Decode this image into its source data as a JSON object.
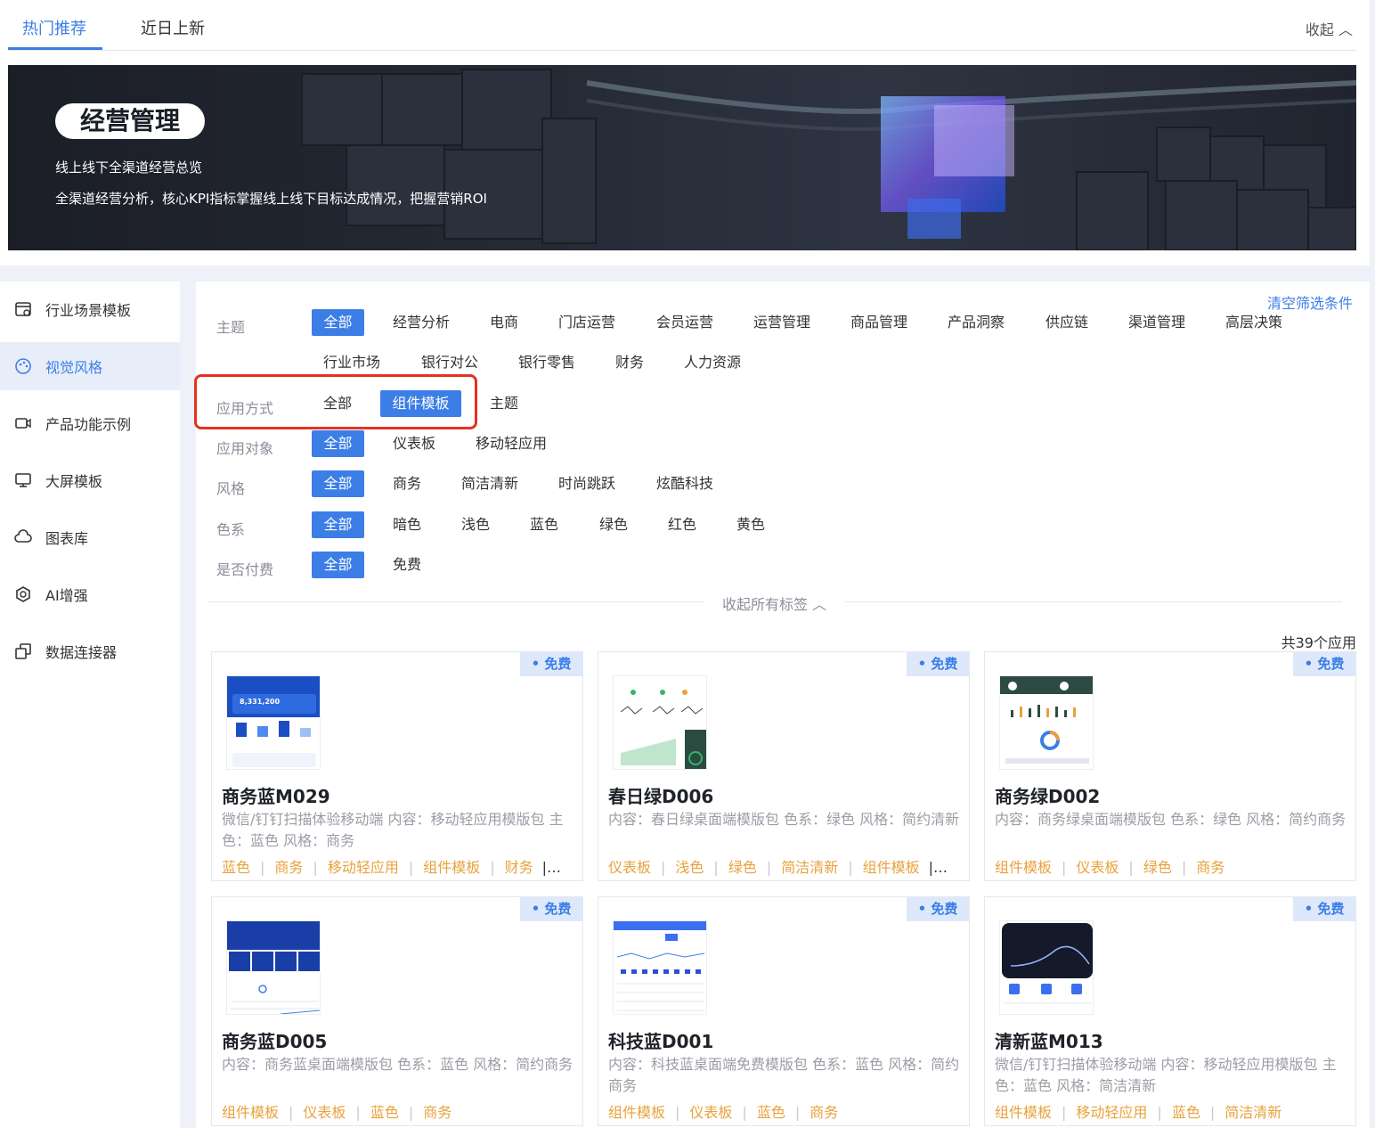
{
  "tabs": [
    {
      "label": "热门推荐"
    },
    {
      "label": "近日上新"
    }
  ],
  "collapse_label": "收起 ︿",
  "banner": {
    "title": "经营管理",
    "subtitle": "线上线下全渠道经营总览",
    "description": "全渠道经营分析，核心KPI指标掌握线上线下目标达成情况，把握营销ROI"
  },
  "sidebar": {
    "items": [
      {
        "label": "行业场景模板",
        "icon": "template-icon"
      },
      {
        "label": "视觉风格",
        "icon": "palette-icon"
      },
      {
        "label": "产品功能示例",
        "icon": "video-icon"
      },
      {
        "label": "大屏模板",
        "icon": "monitor-icon"
      },
      {
        "label": "图表库",
        "icon": "cloud-icon"
      },
      {
        "label": "AI增强",
        "icon": "hexagon-icon"
      },
      {
        "label": "数据连接器",
        "icon": "connector-icon"
      }
    ],
    "active_index": 1
  },
  "filters": {
    "clear_label": "清空筛选条件",
    "rows": [
      {
        "label": "主题",
        "options": [
          "全部",
          "经营分析",
          "电商",
          "门店运营",
          "会员运营",
          "运营管理",
          "商品管理",
          "产品洞察",
          "供应链",
          "渠道管理",
          "高层决策",
          "行业市场",
          "银行对公",
          "银行零售",
          "财务",
          "人力资源"
        ],
        "selected": 0
      },
      {
        "label": "应用方式",
        "options": [
          "全部",
          "组件模板",
          "主题"
        ],
        "selected": 1
      },
      {
        "label": "应用对象",
        "options": [
          "全部",
          "仪表板",
          "移动轻应用"
        ],
        "selected": 0
      },
      {
        "label": "风格",
        "options": [
          "全部",
          "商务",
          "简洁清新",
          "时尚跳跃",
          "炫酷科技"
        ],
        "selected": 0
      },
      {
        "label": "色系",
        "options": [
          "全部",
          "暗色",
          "浅色",
          "蓝色",
          "绿色",
          "红色",
          "黄色"
        ],
        "selected": 0
      },
      {
        "label": "是否付费",
        "options": [
          "全部",
          "免费"
        ],
        "selected": 0
      }
    ],
    "collapse_all_label": "收起所有标签 ︿"
  },
  "results": {
    "count_label": "共39个应用",
    "cards": [
      {
        "badge": "• 免费",
        "title": "商务蓝M029",
        "desc": "微信/钉钉扫描体验移动端 内容：移动轻应用模版包 主色：蓝色 风格：商务",
        "tags": [
          "蓝色",
          "商务",
          "移动轻应用",
          "组件模板",
          "财务"
        ],
        "more": "|…",
        "thumb_value": "8,331,200"
      },
      {
        "badge": "• 免费",
        "title": "春日绿D006",
        "desc": "内容：春日绿桌面端模版包 色系：绿色 风格：简约清新",
        "tags": [
          "仪表板",
          "浅色",
          "绿色",
          "简洁清新",
          "组件模板"
        ],
        "more": "|…"
      },
      {
        "badge": "• 免费",
        "title": "商务绿D002",
        "desc": "内容：商务绿桌面端模版包 色系：绿色 风格：简约商务",
        "tags": [
          "组件模板",
          "仪表板",
          "绿色",
          "商务"
        ],
        "more": ""
      },
      {
        "badge": "• 免费",
        "title": "商务蓝D005",
        "desc": "内容：商务蓝桌面端模版包 色系：蓝色 风格：简约商务",
        "tags": [
          "组件模板",
          "仪表板",
          "蓝色",
          "商务"
        ],
        "more": ""
      },
      {
        "badge": "• 免费",
        "title": "科技蓝D001",
        "desc": "内容：科技蓝桌面端免费模版包 色系：蓝色 风格：简约商务",
        "tags": [
          "组件模板",
          "仪表板",
          "蓝色",
          "商务"
        ],
        "more": ""
      },
      {
        "badge": "• 免费",
        "title": "清新蓝M013",
        "desc": "微信/钉钉扫描体验移动端 内容：移动轻应用模版包 主色：蓝色 风格：简洁清新",
        "tags": [
          "组件模板",
          "移动轻应用",
          "蓝色",
          "简洁清新"
        ],
        "more": ""
      }
    ]
  },
  "colors": {
    "accent": "#3c7ee6",
    "tag": "#e8a23c",
    "highlight": "#e53224"
  }
}
